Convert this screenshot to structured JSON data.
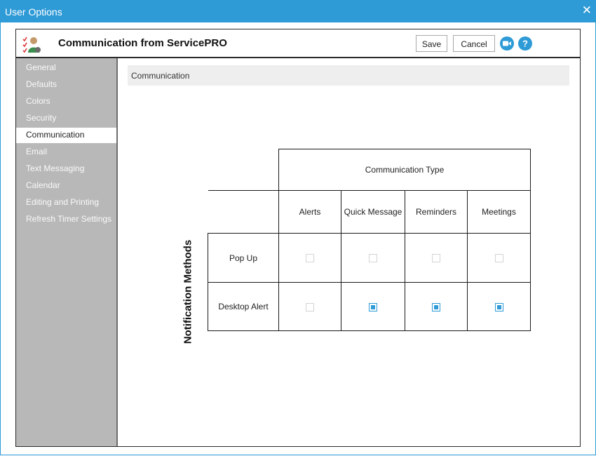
{
  "window": {
    "title": "User Options",
    "close_glyph": "✕"
  },
  "header": {
    "icon": "user-checklist-icon",
    "title": "Communication from ServicePRO",
    "save_label": "Save",
    "cancel_label": "Cancel",
    "video_icon": "video-camera-icon",
    "help_icon": "help-icon"
  },
  "sidebar": {
    "items": [
      {
        "label": "General",
        "active": false
      },
      {
        "label": "Defaults",
        "active": false
      },
      {
        "label": "Colors",
        "active": false
      },
      {
        "label": "Security",
        "active": false
      },
      {
        "label": "Communication",
        "active": true
      },
      {
        "label": "Email",
        "active": false
      },
      {
        "label": "Text Messaging",
        "active": false
      },
      {
        "label": "Calendar",
        "active": false
      },
      {
        "label": "Editing and Printing",
        "active": false
      },
      {
        "label": "Refresh Timer Settings",
        "active": false
      }
    ]
  },
  "section": {
    "title": "Communication"
  },
  "matrix": {
    "column_group_label": "Communication Type",
    "row_group_label": "Notification Methods",
    "columns": [
      "Alerts",
      "Quick Message",
      "Reminders",
      "Meetings"
    ],
    "rows": [
      {
        "label": "Pop Up",
        "values": [
          false,
          false,
          false,
          false
        ]
      },
      {
        "label": "Desktop Alert",
        "values": [
          false,
          true,
          true,
          true
        ]
      }
    ]
  },
  "colors": {
    "accent": "#2e9ad6",
    "sidebar": "#b8b8b8",
    "section_bar": "#eeeeee"
  }
}
